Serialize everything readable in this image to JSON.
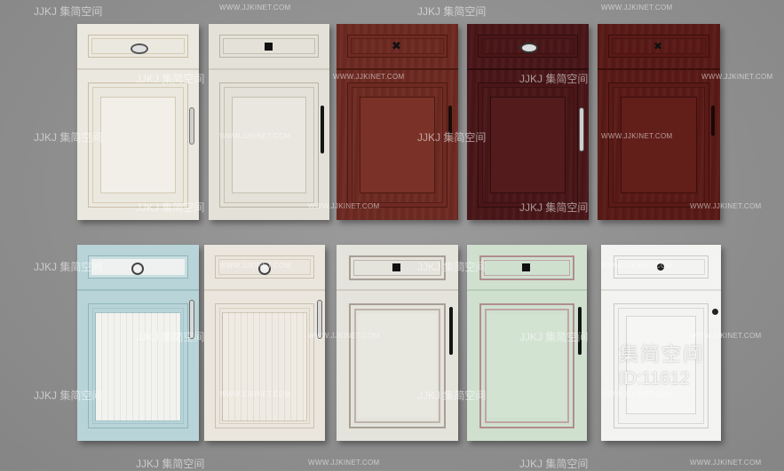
{
  "watermark": {
    "logo_text": "JJKJ 集简空间",
    "url_text": "WWW.JJKINET.COM",
    "id_cn": "集简空间",
    "id_num": "ID:11612"
  },
  "cabinets": [
    {
      "name": "cream-raised",
      "color": "#ebe8df",
      "trim": "#c8bea4",
      "handle": "knob-oval"
    },
    {
      "name": "light-grey",
      "color": "#e3e1d8",
      "trim": "#b7b3a4",
      "handle": "bar-black"
    },
    {
      "name": "cherry-wood",
      "color": "#6e2a22",
      "trim": "#4c1812",
      "handle": "knob-black"
    },
    {
      "name": "dark-mahogany",
      "color": "#4a1618",
      "trim": "#2f0c0e",
      "handle": "knob-silver"
    },
    {
      "name": "red-mahogany",
      "color": "#5a1a16",
      "trim": "#3b0f0c",
      "handle": "knob-black"
    },
    {
      "name": "blue-grooved",
      "color": "#b8d4d8",
      "trim": "#8fb4ba",
      "handle": "knob-round"
    },
    {
      "name": "ivory-grooved",
      "color": "#ebe6dd",
      "trim": "#c6bfb0",
      "handle": "knob-round"
    },
    {
      "name": "warm-grey",
      "color": "#e4e3dc",
      "trim": "#a89f95",
      "handle": "bar-black"
    },
    {
      "name": "mint-green",
      "color": "#cfe0cf",
      "trim": "#b08d8d",
      "handle": "bar-black"
    },
    {
      "name": "white-shaker",
      "color": "#f3f3f1",
      "trim": "#c9c9c6",
      "handle": "knob-dark"
    }
  ]
}
